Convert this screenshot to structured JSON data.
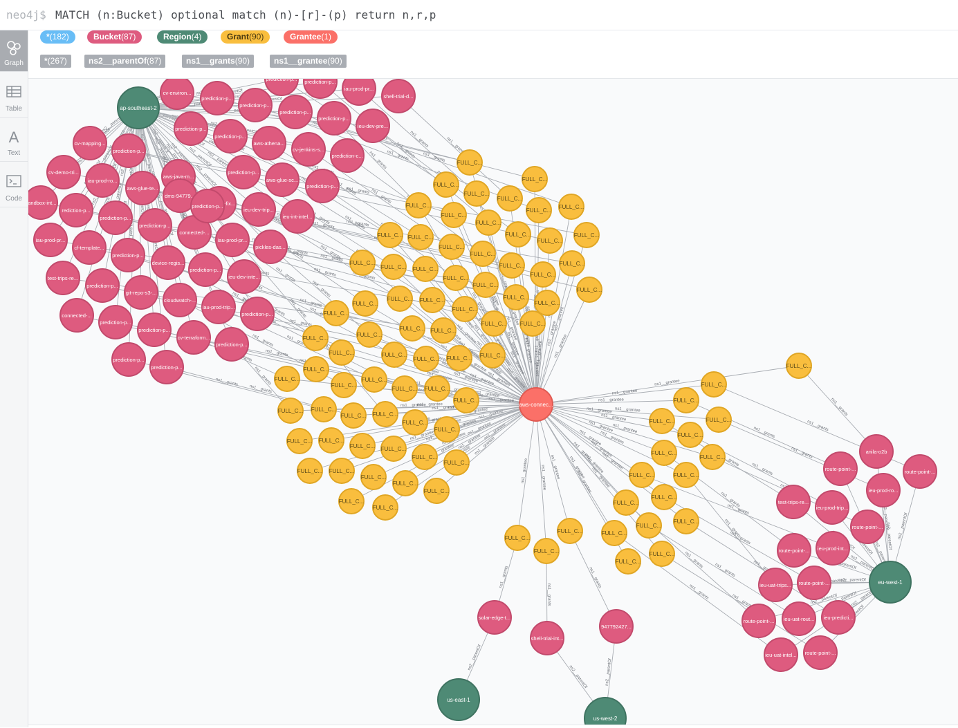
{
  "query": {
    "prompt": "neo4j$",
    "text": "MATCH (n:Bucket) optional match (n)-[r]-(p) return n,r,p"
  },
  "sidebar": {
    "items": [
      {
        "label": "Graph",
        "icon": "graph-icon",
        "active": true
      },
      {
        "label": "Table",
        "icon": "table-icon",
        "active": false
      },
      {
        "label": "Text",
        "icon": "text-icon",
        "active": false
      },
      {
        "label": "Code",
        "icon": "code-icon",
        "active": false
      }
    ]
  },
  "labels": [
    {
      "name": "*",
      "count": "(182)",
      "color": "#68bdf6"
    },
    {
      "name": "Bucket",
      "count": "(87)",
      "color": "#de5b7f"
    },
    {
      "name": "Region",
      "count": "(4)",
      "color": "#4e8a75"
    },
    {
      "name": "Grant",
      "count": "(90)",
      "color": "#f9be3e"
    },
    {
      "name": "Grantee",
      "count": "(1)",
      "color": "#fb7068"
    }
  ],
  "relationships": [
    {
      "name": "*",
      "count": "(267)"
    },
    {
      "name": "ns2__parentOf",
      "count": "(87)"
    },
    {
      "name": "ns1__grants",
      "count": "(90)"
    },
    {
      "name": "ns1__grantee",
      "count": "(90)"
    }
  ],
  "colors": {
    "bucket": "#de5b7f",
    "bucket_stroke": "#c24a6c",
    "region": "#4e8a75",
    "region_stroke": "#3f7361",
    "grant": "#f9be3e",
    "grant_stroke": "#e0a624",
    "grantee": "#fb7068",
    "grantee_stroke": "#e05a52",
    "edge": "#a8acb2"
  },
  "graph": {
    "grant_label": "FULL_C...",
    "rel_grants": "ns1__grants",
    "rel_grantee": "ns1__grantee",
    "rel_parent": "ns2__parentOf",
    "grantee": {
      "label": "aws-connec..."
    },
    "regions": [
      {
        "id": "r-ap",
        "label": "ap-southeast-2"
      },
      {
        "id": "r-euw",
        "label": "eu-west-1"
      },
      {
        "id": "r-use",
        "label": "us-east-1"
      },
      {
        "id": "r-usw",
        "label": "us-west-2"
      }
    ],
    "buckets_left": [
      "cv-environ...",
      "prediction-p...",
      "prediction-p...",
      "iau-prod-pr...",
      "shell-trial-d...",
      "prediction-p...",
      "prediction-p...",
      "prediction-p...",
      "prediction-p...",
      "prediction-p...",
      "ieu-dev-pre...",
      "cv-mapping...",
      "prediction-p...",
      "prediction-p...",
      "aws-athena...",
      "cv-jenkins-s...",
      "prediction-c...",
      "cv-demo-tri...",
      "iau-prod-ro...",
      "aws-glue-te...",
      "aws-java-m...",
      "prediction-p...",
      "aws-glue-sc...",
      "prediction-p...",
      "sandbox-int...",
      "rediction-p...",
      "prediction-p...",
      "dms-94779...",
      "trip-route-fix...",
      "ieu-dev-trip...",
      "ieu-int-intel...",
      "iau-prod-pr...",
      "prediction-p...",
      "connected-...",
      "iau-prod-pr...",
      "pickles-das...",
      "cf-template...",
      "test-trips-re...",
      "prediction-p...",
      "device-regis...",
      "prediction-p...",
      "ieu-dev-inte...",
      "prediction-p...",
      "git-repo-s3-...",
      "connected-...",
      "cloudwatch-...",
      "iau-prod-trip...",
      "prediction-p...",
      "prediction-p...",
      "prediction-p...",
      "cv-terraform...",
      "prediction-p...",
      "prediction-p...",
      "prediction-p...",
      "prediction-p..."
    ],
    "buckets_right": [
      "anila-o2b",
      "route-point-...",
      "route-point-...",
      "ieu-prod-ro...",
      "test-trips-re...",
      "ieu-prod-trip...",
      "route-point-...",
      "route-point-...",
      "ieu-prod-int...",
      "ieu-uat-trips...",
      "route-point-...",
      "route-point-...",
      "ieu-uat-rout...",
      "ieu-predicti...",
      "ieu-uat-intel...",
      "route-point-..."
    ],
    "buckets_bottom": [
      "solar-edge-t...",
      "shell-trial-int...",
      "947792427..."
    ]
  }
}
